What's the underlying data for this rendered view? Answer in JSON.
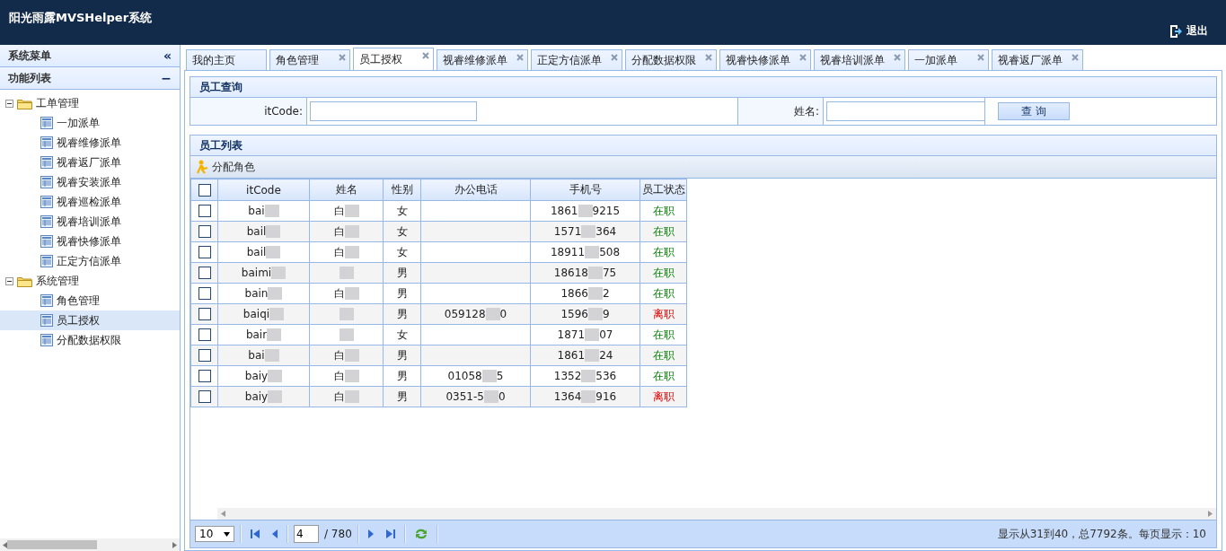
{
  "header": {
    "title": "阳光雨露MVSHelper系统",
    "logout": "退出"
  },
  "sidebar": {
    "title": "系统菜单",
    "collapse": "«",
    "section": "功能列表",
    "section_toggle": "−",
    "tree": [
      {
        "label": "工单管理",
        "expanded": true,
        "children": [
          {
            "label": "一加派单",
            "selected": false
          },
          {
            "label": "视睿维修派单",
            "selected": false
          },
          {
            "label": "视睿返厂派单",
            "selected": false
          },
          {
            "label": "视睿安装派单",
            "selected": false
          },
          {
            "label": "视睿巡检派单",
            "selected": false
          },
          {
            "label": "视睿培训派单",
            "selected": false
          },
          {
            "label": "视睿快修派单",
            "selected": false
          },
          {
            "label": "正定方信派单",
            "selected": false
          }
        ]
      },
      {
        "label": "系统管理",
        "expanded": true,
        "children": [
          {
            "label": "角色管理",
            "selected": false
          },
          {
            "label": "员工授权",
            "selected": true
          },
          {
            "label": "分配数据权限",
            "selected": false
          }
        ]
      }
    ]
  },
  "tabs": [
    {
      "label": "我的主页",
      "selected": false,
      "closable": false
    },
    {
      "label": "角色管理",
      "selected": false,
      "closable": true
    },
    {
      "label": "员工授权",
      "selected": true,
      "closable": true
    },
    {
      "label": "视睿维修派单",
      "selected": false,
      "closable": true
    },
    {
      "label": "正定方信派单",
      "selected": false,
      "closable": true
    },
    {
      "label": "分配数据权限",
      "selected": false,
      "closable": true
    },
    {
      "label": "视睿快修派单",
      "selected": false,
      "closable": true
    },
    {
      "label": "视睿培训派单",
      "selected": false,
      "closable": true
    },
    {
      "label": "一加派单",
      "selected": false,
      "closable": true
    },
    {
      "label": "视睿返厂派单",
      "selected": false,
      "closable": true
    }
  ],
  "query": {
    "title": "员工查询",
    "fields": [
      {
        "label": "itCode:"
      },
      {
        "label": "姓名:"
      }
    ],
    "button": "查 询"
  },
  "list": {
    "title": "员工列表",
    "toolbar": "分配角色",
    "all_checked": false,
    "columns": [
      "itCode",
      "姓名",
      "性别",
      "办公电话",
      "手机号",
      "员工状态"
    ],
    "rows": [
      {
        "checked": false,
        "itcode": [
          "bai"
        ],
        "name": [
          "白"
        ],
        "gender": "女",
        "office": [],
        "mobile": [
          "1861",
          "9215"
        ],
        "status": "在职",
        "kind": "active"
      },
      {
        "checked": false,
        "itcode": [
          "bail"
        ],
        "name": [
          "白"
        ],
        "gender": "女",
        "office": [],
        "mobile": [
          "1571",
          "364"
        ],
        "status": "在职",
        "kind": "active"
      },
      {
        "checked": false,
        "itcode": [
          "bail"
        ],
        "name": [
          "白"
        ],
        "gender": "女",
        "office": [],
        "mobile": [
          "18911",
          "508"
        ],
        "status": "在职",
        "kind": "active"
      },
      {
        "checked": false,
        "itcode": [
          "baimi"
        ],
        "name": [],
        "gender": "男",
        "office": [],
        "mobile": [
          "18618",
          "75"
        ],
        "status": "在职",
        "kind": "active"
      },
      {
        "checked": false,
        "itcode": [
          "bain"
        ],
        "name": [
          "白"
        ],
        "gender": "男",
        "office": [],
        "mobile": [
          "1866",
          "2"
        ],
        "status": "在职",
        "kind": "active"
      },
      {
        "checked": false,
        "itcode": [
          "baiqi"
        ],
        "name": [],
        "gender": "男",
        "office": [
          "059128",
          "0"
        ],
        "mobile": [
          "1596",
          "9"
        ],
        "status": "离职",
        "kind": "left"
      },
      {
        "checked": false,
        "itcode": [
          "bair"
        ],
        "name": [],
        "gender": "女",
        "office": [],
        "mobile": [
          "1871",
          "07"
        ],
        "status": "在职",
        "kind": "active"
      },
      {
        "checked": false,
        "itcode": [
          "bai"
        ],
        "name": [
          "白"
        ],
        "gender": "男",
        "office": [],
        "mobile": [
          "1861",
          "24"
        ],
        "status": "在职",
        "kind": "active"
      },
      {
        "checked": false,
        "itcode": [
          "baiy"
        ],
        "name": [
          "白"
        ],
        "gender": "男",
        "office": [
          "01058",
          "5"
        ],
        "mobile": [
          "1352",
          "536"
        ],
        "status": "在职",
        "kind": "active"
      },
      {
        "checked": false,
        "itcode": [
          "baiy"
        ],
        "name": [
          "白"
        ],
        "gender": "男",
        "office": [
          "0351-5",
          "0"
        ],
        "mobile": [
          "1364",
          "916"
        ],
        "status": "离职",
        "kind": "left"
      }
    ]
  },
  "pager": {
    "page_size": "10",
    "page": "4",
    "total_pages": "/ 780",
    "summary": "显示从31到40，总7792条。每页显示：10"
  }
}
